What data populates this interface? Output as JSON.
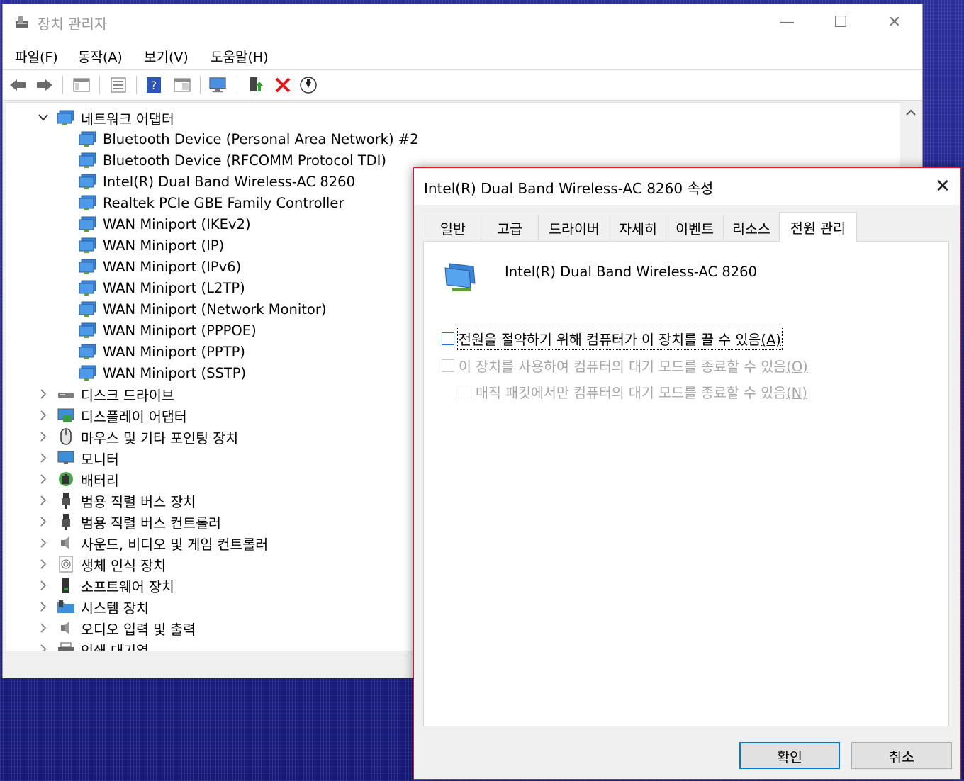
{
  "device_manager": {
    "title": "장치 관리자",
    "window_buttons": {
      "minimize": "—",
      "maximize": "☐",
      "close": "✕"
    },
    "menu": [
      "파일(F)",
      "동작(A)",
      "보기(V)",
      "도움말(H)"
    ],
    "toolbar_icons": [
      "back-icon",
      "forward-icon",
      "show-hide-console-tree-icon",
      "properties-icon",
      "help-icon",
      "view-icon",
      "scan-hardware-icon",
      "update-driver-icon",
      "uninstall-icon",
      "disable-device-icon"
    ],
    "tree": {
      "expanded_category": "네트워크 어댑터",
      "network_adapters": [
        "Bluetooth Device (Personal Area Network) #2",
        "Bluetooth Device (RFCOMM Protocol TDI)",
        "Intel(R) Dual Band Wireless-AC 8260",
        "Realtek PCIe GBE Family Controller",
        "WAN Miniport (IKEv2)",
        "WAN Miniport (IP)",
        "WAN Miniport (IPv6)",
        "WAN Miniport (L2TP)",
        "WAN Miniport (Network Monitor)",
        "WAN Miniport (PPPOE)",
        "WAN Miniport (PPTP)",
        "WAN Miniport (SSTP)"
      ],
      "categories": [
        {
          "label": "디스크 드라이브",
          "icon": "disk-drive-icon"
        },
        {
          "label": "디스플레이 어댑터",
          "icon": "display-adapter-icon"
        },
        {
          "label": "마우스 및 기타 포인팅 장치",
          "icon": "mouse-icon"
        },
        {
          "label": "모니터",
          "icon": "monitor-icon"
        },
        {
          "label": "배터리",
          "icon": "battery-icon"
        },
        {
          "label": "범용 직렬 버스 장치",
          "icon": "usb-icon"
        },
        {
          "label": "범용 직렬 버스 컨트롤러",
          "icon": "usb-icon"
        },
        {
          "label": "사운드, 비디오 및 게임 컨트롤러",
          "icon": "speaker-icon"
        },
        {
          "label": "생체 인식 장치",
          "icon": "fingerprint-icon"
        },
        {
          "label": "소프트웨어 장치",
          "icon": "software-device-icon"
        },
        {
          "label": "시스템 장치",
          "icon": "system-folder-icon"
        },
        {
          "label": "오디오 입력 및 출력",
          "icon": "speaker-icon"
        },
        {
          "label": "인쇄 대기열",
          "icon": "printer-icon"
        }
      ]
    }
  },
  "properties_dialog": {
    "title": "Intel(R) Dual Band Wireless-AC 8260 속성",
    "close": "✕",
    "tabs": [
      "일반",
      "고급",
      "드라이버",
      "자세히",
      "이벤트",
      "리소스",
      "전원 관리"
    ],
    "active_tab": "전원 관리",
    "device_name": "Intel(R) Dual Band Wireless-AC 8260",
    "options": [
      {
        "text": "전원을 절약하기 위해 컴퓨터가 이 장치를 끌 수 있음",
        "key": "(A)",
        "checked": false,
        "enabled": true
      },
      {
        "text": "이 장치를 사용하여 컴퓨터의 대기 모드를 종료할 수 있음",
        "key": "(O)",
        "checked": false,
        "enabled": false
      },
      {
        "text": "매직 패킷에서만 컴퓨터의 대기 모드를 종료할 수 있음",
        "key": "(N)",
        "checked": false,
        "enabled": false
      }
    ],
    "ok_label": "확인",
    "cancel_label": "취소"
  }
}
